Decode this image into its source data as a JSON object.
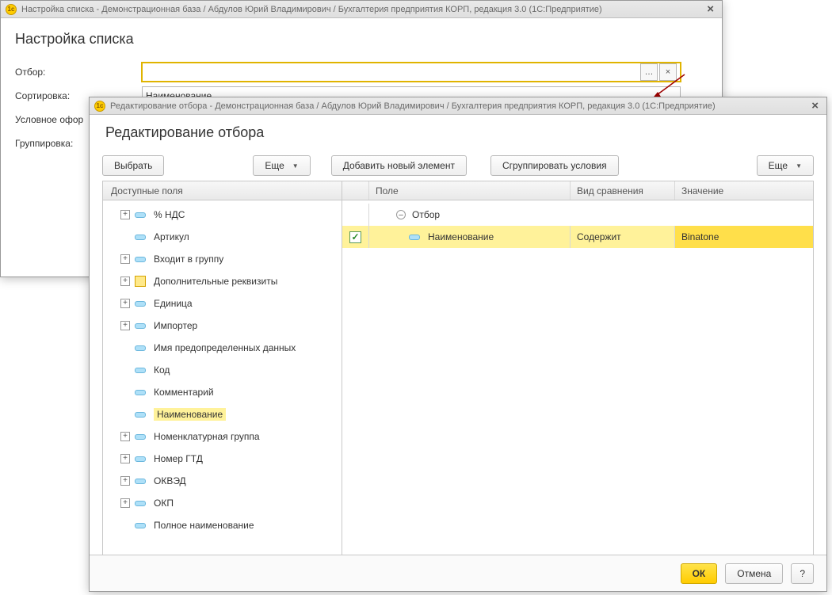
{
  "back_window": {
    "title": "Настройка списка - Демонстрационная база / Абдулов Юрий Владимирович / Бухгалтерия предприятия КОРП, редакция 3.0  (1С:Предприятие)",
    "heading": "Настройка списка",
    "rows": {
      "filter_label": "Отбор:",
      "sort_label": "Сортировка:",
      "sort_value": "Наименование",
      "cond_label": "Условное офор",
      "group_label": "Группировка:"
    }
  },
  "front_window": {
    "title": "Редактирование отбора - Демонстрационная база / Абдулов Юрий Владимирович / Бухгалтерия предприятия КОРП, редакция 3.0  (1С:Предприятие)",
    "heading": "Редактирование отбора",
    "toolbar": {
      "select": "Выбрать",
      "more": "Еще",
      "add": "Добавить новый элемент",
      "group": "Сгруппировать условия",
      "more2": "Еще"
    },
    "left": {
      "header": "Доступные поля",
      "items": [
        {
          "exp": "+",
          "icon": "pill",
          "label": "% НДС"
        },
        {
          "exp": "",
          "icon": "pill",
          "label": "Артикул"
        },
        {
          "exp": "+",
          "icon": "pill",
          "label": "Входит в группу"
        },
        {
          "exp": "+",
          "icon": "fld",
          "label": "Дополнительные реквизиты"
        },
        {
          "exp": "+",
          "icon": "pill",
          "label": "Единица"
        },
        {
          "exp": "+",
          "icon": "pill",
          "label": "Импортер"
        },
        {
          "exp": "",
          "icon": "pill",
          "label": "Имя предопределенных данных"
        },
        {
          "exp": "",
          "icon": "pill",
          "label": "Код"
        },
        {
          "exp": "",
          "icon": "pill",
          "label": "Комментарий"
        },
        {
          "exp": "",
          "icon": "pill",
          "label": "Наименование",
          "highlight": true
        },
        {
          "exp": "+",
          "icon": "pill",
          "label": "Номенклатурная группа"
        },
        {
          "exp": "+",
          "icon": "pill",
          "label": "Номер ГТД"
        },
        {
          "exp": "+",
          "icon": "pill",
          "label": "ОКВЭД"
        },
        {
          "exp": "+",
          "icon": "pill",
          "label": "ОКП"
        },
        {
          "exp": "",
          "icon": "pill",
          "label": "Полное наименование"
        }
      ]
    },
    "right": {
      "columns": {
        "field": "Поле",
        "cmp": "Вид сравнения",
        "val": "Значение"
      },
      "root": "Отбор",
      "row": {
        "field": "Наименование",
        "cmp": "Содержит",
        "val": "Binatone"
      }
    },
    "footer": {
      "ok": "ОК",
      "cancel": "Отмена",
      "help": "?"
    }
  }
}
